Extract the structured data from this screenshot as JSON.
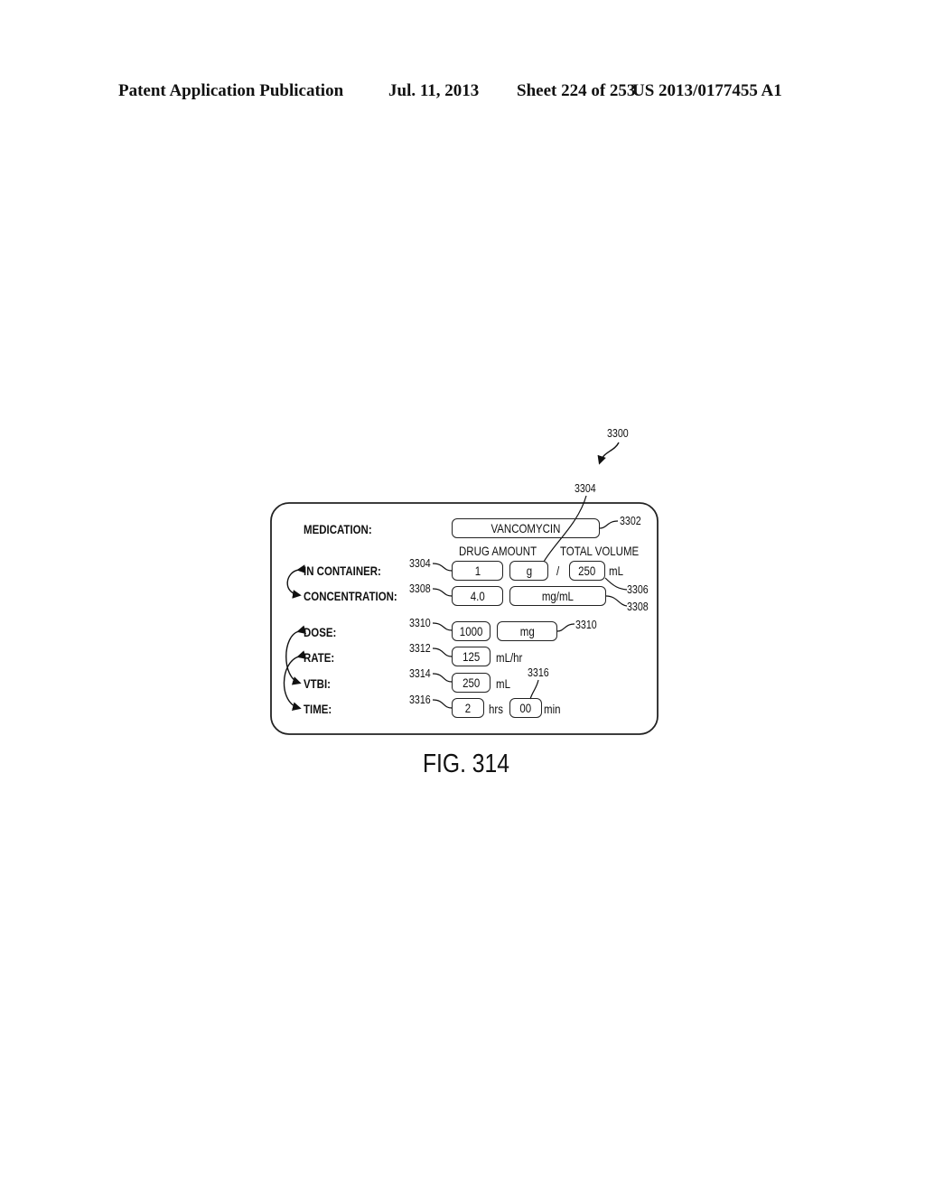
{
  "header": {
    "publication": "Patent Application Publication",
    "date": "Jul. 11, 2013",
    "sheet": "Sheet 224 of 253",
    "number": "US 2013/0177455 A1"
  },
  "figure": {
    "ref": "3300",
    "caption": "FIG. 314",
    "labels": {
      "medication": "MEDICATION:",
      "in_container": "IN CONTAINER:",
      "concentration": "CONCENTRATION:",
      "dose": "DOSE:",
      "rate": "RATE:",
      "vtbi": "VTBI:",
      "time": "TIME:"
    },
    "column_headers": {
      "drug_amount": "DRUG AMOUNT",
      "total_volume": "TOTAL VOLUME"
    },
    "fields": {
      "medication": "VANCOMYCIN",
      "drug_amount": "1",
      "drug_unit": "g",
      "separator": "/",
      "total_volume": "250",
      "total_volume_unit": "mL",
      "concentration": "4.0",
      "concentration_unit": "mg/mL",
      "dose": "1000",
      "dose_unit": "mg",
      "rate": "125",
      "rate_unit": "mL/hr",
      "vtbi": "250",
      "vtbi_unit": "mL",
      "time_hrs": "2",
      "hrs_unit": "hrs",
      "time_min": "00",
      "min_unit": "min"
    },
    "refs": {
      "r3302": "3302",
      "r3304_top": "3304",
      "r3304_left": "3304",
      "r3306": "3306",
      "r3308_left": "3308",
      "r3308_right": "3308",
      "r3310_left": "3310",
      "r3310_right": "3310",
      "r3312": "3312",
      "r3314": "3314",
      "r3316_left": "3316",
      "r3316_top": "3316"
    }
  }
}
